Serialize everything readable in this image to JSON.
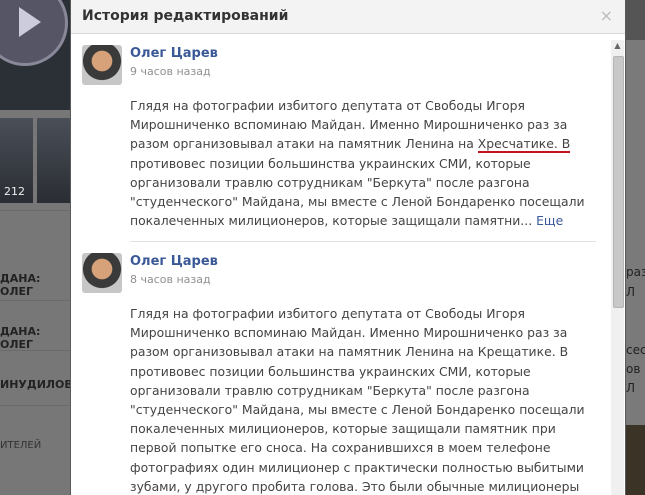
{
  "background": {
    "photo_count": "212",
    "left_strips": [
      "ДАНА: ОЛЕГ",
      "ДАНА: ОЛЕГ",
      "ИНУДИЛОВ",
      "ИТЕЛЕЙ"
    ],
    "right_strips": [
      "раз",
      "Л",
      "",
      "сесл",
      "ов",
      "Л"
    ]
  },
  "modal": {
    "title": "История редактирований",
    "close_glyph": "×",
    "entries": [
      {
        "author": "Олег Царев",
        "time": "9 часов назад",
        "text_before": "Глядя на фотографии избитого депутата от Свободы Игоря Мирошниченко вспоминаю Майдан. Именно Мирошниченко раз за разом организовывал атаки на памятник Ленина на ",
        "marked_word": "Хресчатике. В",
        "text_after": " противовес позиции большинства украинских СМИ, которые организовали травлю сотрудникам \"Беркута\" после разгона \"студенческого\" Майдана, мы вместе с Леной Бондаренко посещали покалеченных милиционеров, которые защищали памятни...",
        "more": "Еще"
      },
      {
        "author": "Олег Царев",
        "time": "8 часов назад",
        "text": "Глядя на фотографии избитого депутата от Свободы Игоря Мирошниченко вспоминаю Майдан. Именно Мирошниченко раз за разом организовывал атаки на памятник Ленина на Крещатике. В противовес позиции большинства украинских СМИ, которые организовали травлю сотрудникам \"Беркута\" после разгона \"студенческого\" Майдана, мы вместе с Леной Бондаренко посещали покалеченных милиционеров, которые защищали памятник при первой попытке его сноса. На сохранившихся в моем телефоне фотографиях один милиционер с практически полностью выбитыми зубами, у другого пробита голова. Это были обычные милиционеры"
      }
    ]
  }
}
